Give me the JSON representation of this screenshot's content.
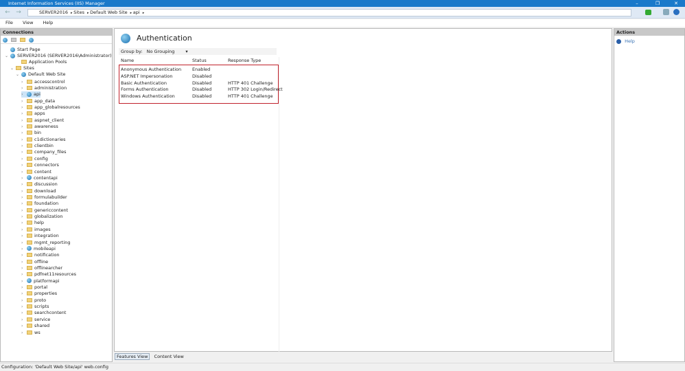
{
  "window": {
    "title": "Internet Information Services (IIS) Manager",
    "minimize": "–",
    "restore": "❐",
    "close": "✕"
  },
  "address": {
    "crumbs": [
      "SERVER2016",
      "Sites",
      "Default Web Site",
      "api"
    ]
  },
  "menu": [
    "File",
    "View",
    "Help"
  ],
  "connections": {
    "title": "Connections",
    "start_page": "Start Page",
    "server": "SERVER2016 (SERVER2016\\Administrator)",
    "app_pools": "Application Pools",
    "sites": "Sites",
    "site": "Default Web Site",
    "items": [
      {
        "n": "accesscontrol"
      },
      {
        "n": "administration"
      },
      {
        "n": "api",
        "app": true,
        "selected": true
      },
      {
        "n": "app_data"
      },
      {
        "n": "app_globalresources"
      },
      {
        "n": "apps"
      },
      {
        "n": "aspnet_client"
      },
      {
        "n": "awareness"
      },
      {
        "n": "bin"
      },
      {
        "n": "c1dictionaries"
      },
      {
        "n": "clientbin"
      },
      {
        "n": "company_files"
      },
      {
        "n": "config"
      },
      {
        "n": "connectors"
      },
      {
        "n": "content"
      },
      {
        "n": "contentapi",
        "app": true
      },
      {
        "n": "discussion"
      },
      {
        "n": "download"
      },
      {
        "n": "formulabuilder"
      },
      {
        "n": "foundation"
      },
      {
        "n": "genericcontent"
      },
      {
        "n": "globalization"
      },
      {
        "n": "help"
      },
      {
        "n": "images"
      },
      {
        "n": "integration"
      },
      {
        "n": "mgmt_reporting"
      },
      {
        "n": "mobileapi",
        "app": true
      },
      {
        "n": "notification"
      },
      {
        "n": "offline"
      },
      {
        "n": "offlinearcher"
      },
      {
        "n": "pdfnet11resources"
      },
      {
        "n": "platformapi",
        "app": true
      },
      {
        "n": "portal"
      },
      {
        "n": "properties"
      },
      {
        "n": "proto"
      },
      {
        "n": "scripts"
      },
      {
        "n": "searchcontent"
      },
      {
        "n": "service"
      },
      {
        "n": "shared"
      },
      {
        "n": "ws"
      }
    ]
  },
  "feature": {
    "title": "Authentication",
    "group_by_label": "Group by:",
    "group_by_value": "No Grouping",
    "columns": [
      "Name",
      "Status",
      "Response Type"
    ],
    "rows": [
      [
        "Anonymous Authentication",
        "Enabled",
        ""
      ],
      [
        "ASP.NET Impersonation",
        "Disabled",
        ""
      ],
      [
        "Basic Authentication",
        "Disabled",
        "HTTP 401 Challenge"
      ],
      [
        "Forms Authentication",
        "Disabled",
        "HTTP 302 Login/Redirect"
      ],
      [
        "Windows Authentication",
        "Disabled",
        "HTTP 401 Challenge"
      ]
    ],
    "highlight_color": "#c0202a"
  },
  "views": {
    "features": "Features View",
    "content": "Content View"
  },
  "actions": {
    "title": "Actions",
    "help": "Help"
  },
  "status": "Configuration: 'Default Web Site/api' web.config"
}
